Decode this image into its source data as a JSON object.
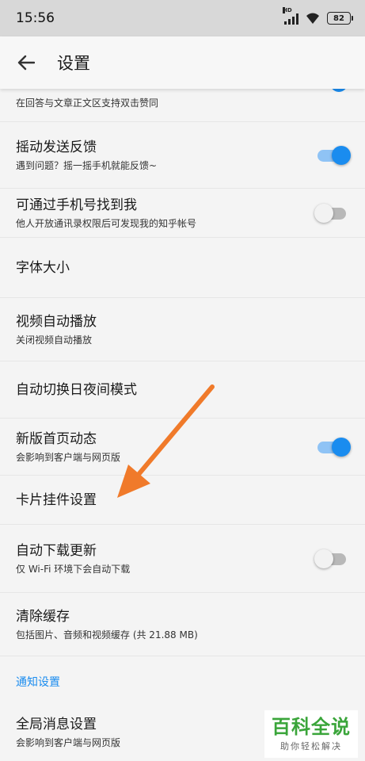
{
  "status_bar": {
    "time": "15:56",
    "network_badge": "HD",
    "battery": "82"
  },
  "app_bar": {
    "title": "设置",
    "back_icon": "back-arrow-icon"
  },
  "partial_row": {
    "subtitle": "在回答与文章正文区支持双击赞同",
    "toggle_on": true
  },
  "settings": [
    {
      "title": "摇动发送反馈",
      "subtitle": "遇到问题？摇一摇手机就能反馈~",
      "toggle": "on"
    },
    {
      "title": "可通过手机号找到我",
      "subtitle": "他人开放通讯录权限后可发现我的知乎帐号",
      "toggle": "off"
    },
    {
      "title": "字体大小",
      "subtitle": "",
      "toggle": "none"
    },
    {
      "title": "视频自动播放",
      "subtitle": "关闭视频自动播放",
      "toggle": "none"
    },
    {
      "title": "自动切换日夜间模式",
      "subtitle": "",
      "toggle": "none"
    },
    {
      "title": "新版首页动态",
      "subtitle": "会影响到客户端与网页版",
      "toggle": "on"
    },
    {
      "title": "卡片挂件设置",
      "subtitle": "",
      "toggle": "none"
    },
    {
      "title": "自动下载更新",
      "subtitle": "仅 Wi-Fi 环境下会自动下载",
      "toggle": "off"
    },
    {
      "title": "清除缓存",
      "subtitle": "包括图片、音频和视频缓存 (共 21.88 MB)",
      "toggle": "none"
    }
  ],
  "notification_section": {
    "header": "通知设置",
    "items": [
      {
        "title": "全局消息设置",
        "subtitle": "会影响到客户端与网页版"
      }
    ]
  },
  "watermark": {
    "title": "百科全说",
    "subtitle": "助你轻松解决"
  },
  "colors": {
    "accent": "#1a8cef",
    "annotation_arrow": "#f07a2a",
    "watermark_green": "#3aa53a"
  }
}
